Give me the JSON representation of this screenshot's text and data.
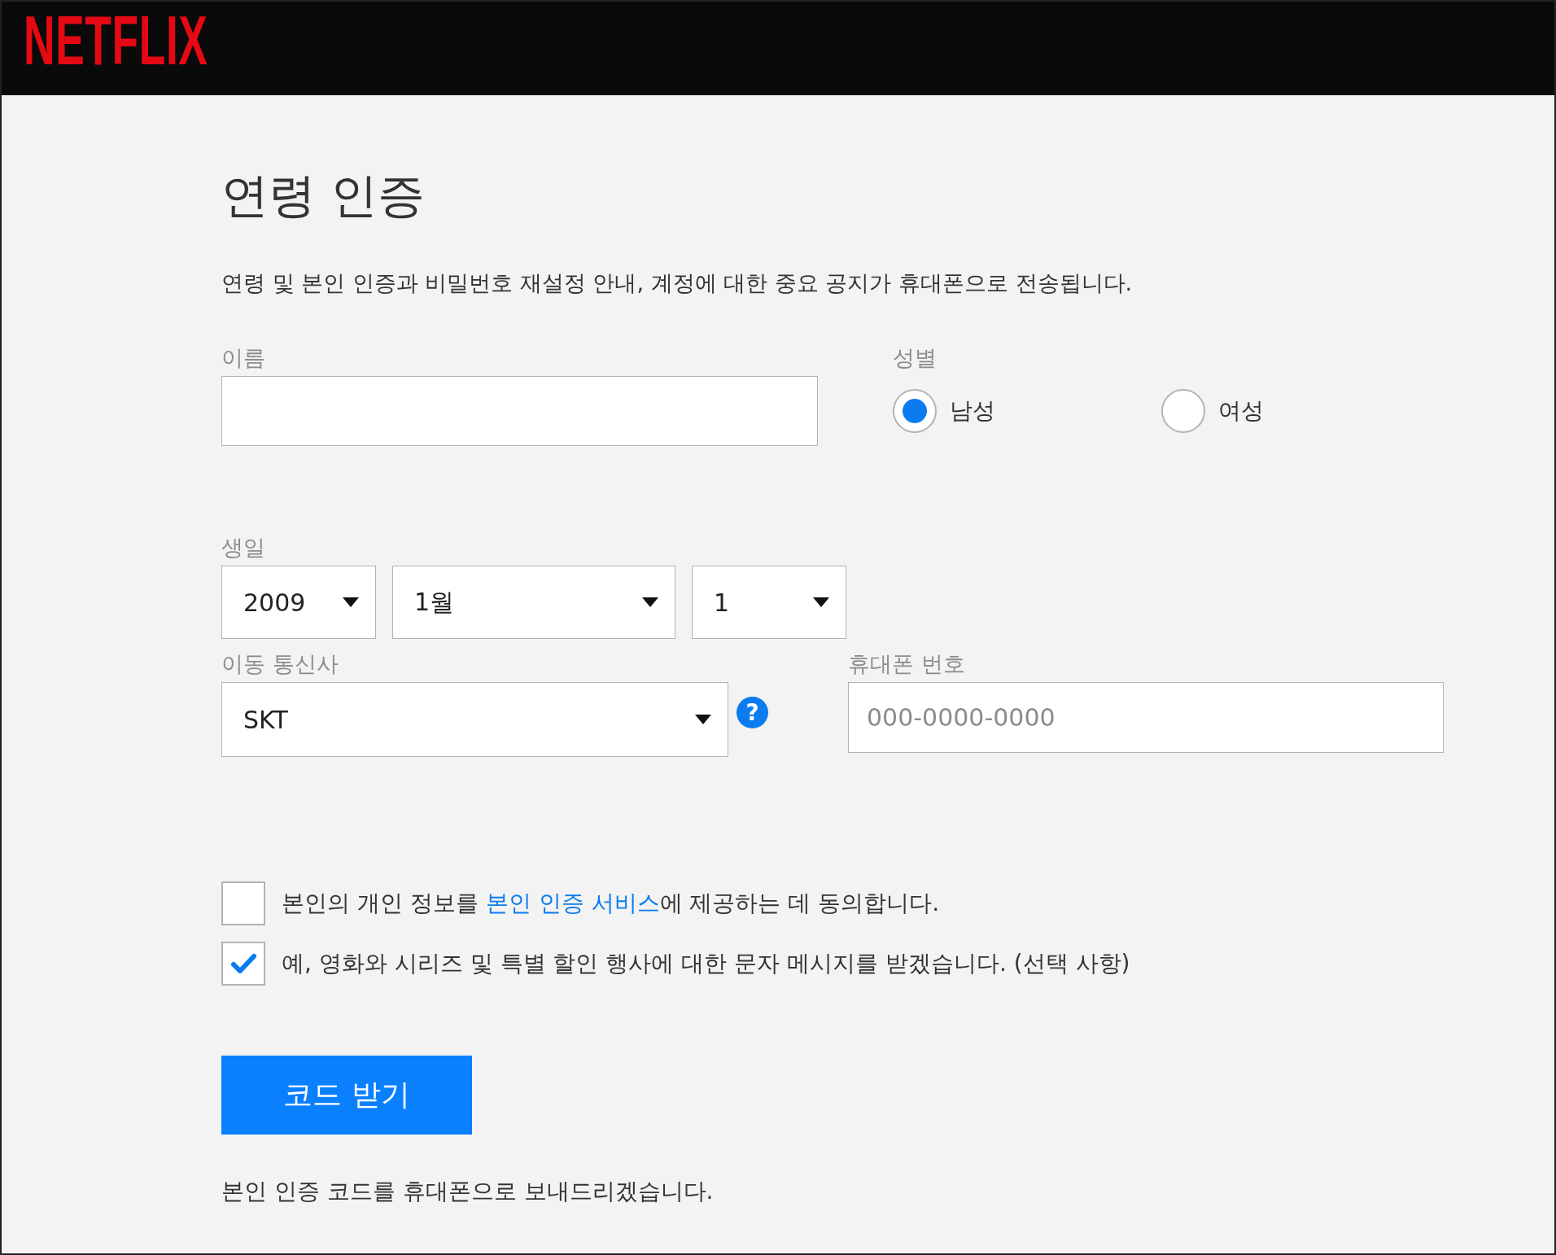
{
  "header": {
    "logo": "NETFLIX"
  },
  "title": "연령 인증",
  "description": "연령 및 본인 인증과 비밀번호 재설정 안내, 계정에 대한 중요 공지가 휴대폰으로 전송됩니다.",
  "name_field": {
    "label": "이름"
  },
  "gender": {
    "label": "성별",
    "options": [
      {
        "label": "남성",
        "selected": true
      },
      {
        "label": "여성",
        "selected": false
      }
    ]
  },
  "birthday": {
    "label": "생일",
    "selects": [
      {
        "value": "2009"
      },
      {
        "value": "1월"
      },
      {
        "value": "1"
      }
    ]
  },
  "carrier": {
    "label": "이동 통신사",
    "value": "SKT",
    "help": "?"
  },
  "phone": {
    "label": "휴대폰 번호",
    "placeholder": "000-0000-0000"
  },
  "consents": [
    {
      "text": "본인의 개인 정보를 ",
      "link": "본인 인증 서비스",
      "text_after": "에 제공하는 데 동의합니다.",
      "checked": false
    },
    {
      "text": "예, 영화와 시리즈 및 특별 할인 행사에 대한 문자 메시지를 받겠습니다. (선택 사항)",
      "checked": true
    }
  ],
  "submit_button": "코드 받기",
  "footer_note": "본인 인증 코드를 휴대폰으로 보내드리겠습니다."
}
